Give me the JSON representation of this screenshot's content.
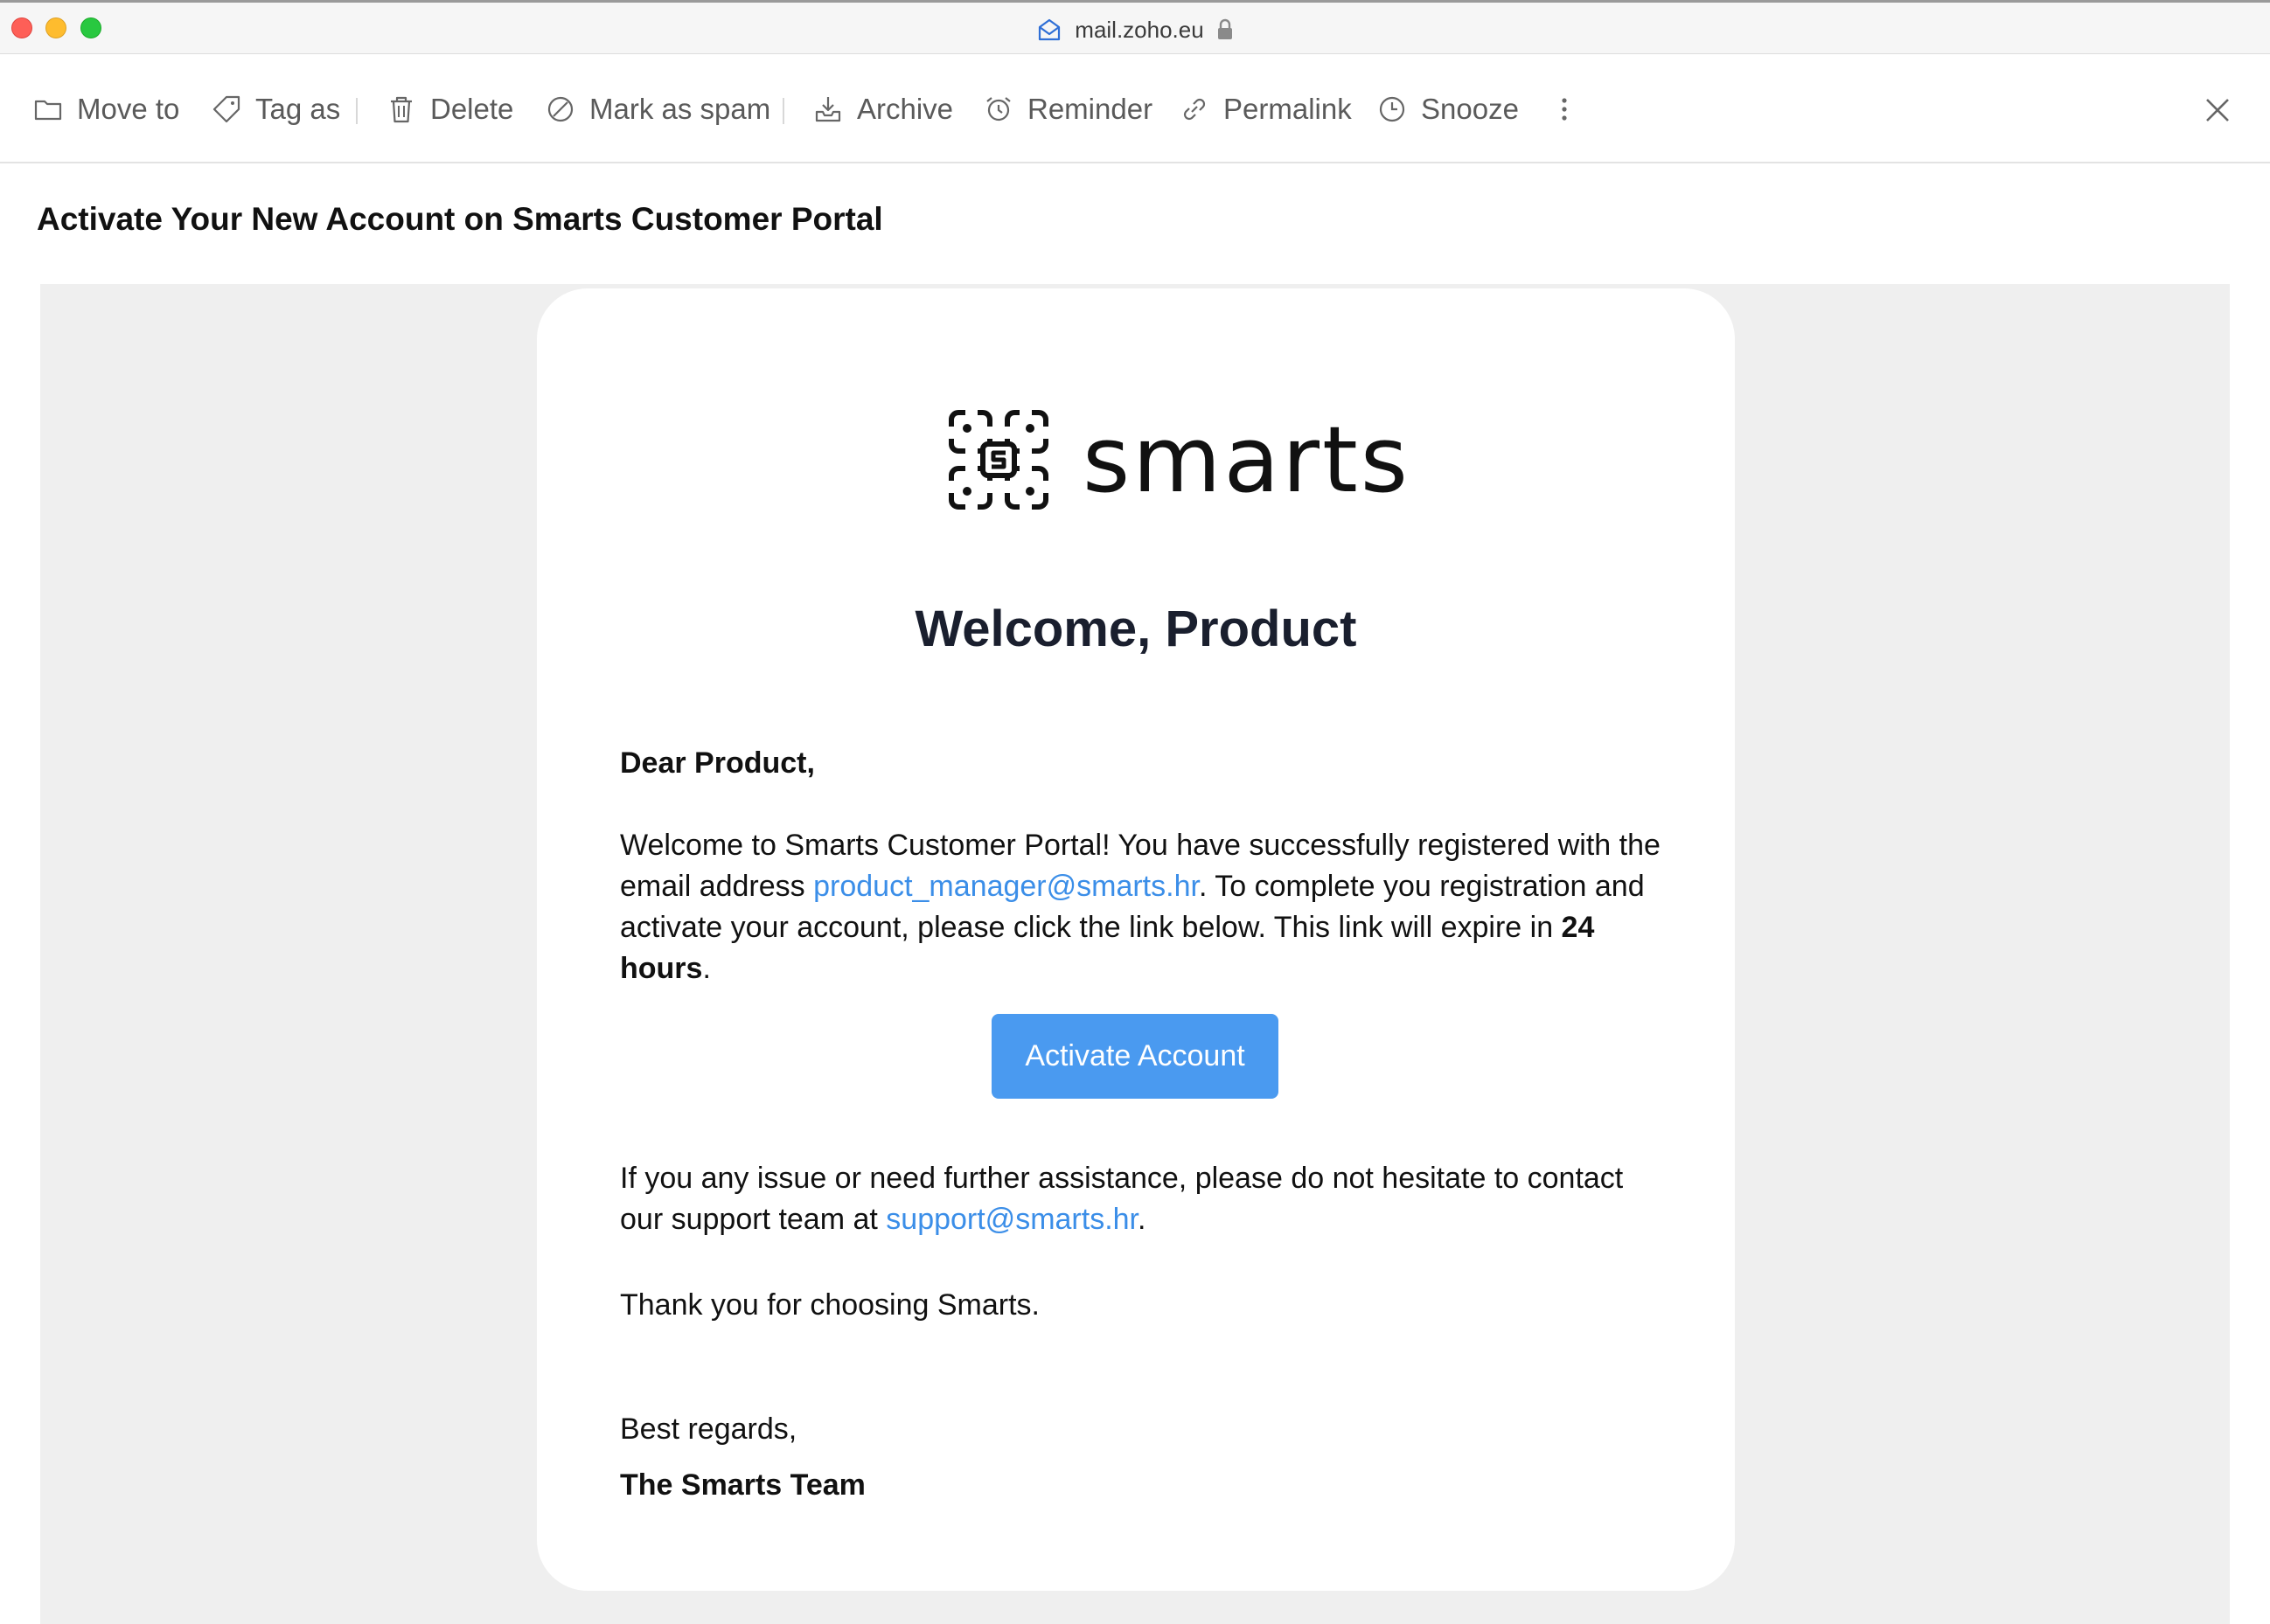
{
  "browser": {
    "url": "mail.zoho.eu"
  },
  "toolbar": {
    "move_to": "Move to",
    "tag_as": "Tag as",
    "delete": "Delete",
    "mark_as_spam": "Mark as spam",
    "archive": "Archive",
    "reminder": "Reminder",
    "permalink": "Permalink",
    "snooze": "Snooze"
  },
  "email": {
    "subject": "Activate Your New Account on Smarts Customer Portal",
    "brand": "smarts",
    "welcome": "Welcome, Product",
    "greeting": "Dear Product,",
    "para1_a": "Welcome to Smarts Customer Portal! You have successfully registered with the email address ",
    "para1_email": "product_manager@smarts.hr",
    "para1_b": ". To complete you registration and activate your account, please click the link below. This link will expire in ",
    "para1_bold": "24 hours",
    "para1_c": ".",
    "button": "Activate Account",
    "para2_a": "If you any issue or need further assistance, please do not hesitate to contact our support team at ",
    "para2_email": "support@smarts.hr",
    "para2_b": ".",
    "thanks": "Thank you for choosing Smarts.",
    "regards": "Best regards,",
    "signature": "The Smarts Team"
  },
  "colors": {
    "link": "#3b8ee8",
    "button_bg": "#4a9af0",
    "background": "#efefef"
  }
}
